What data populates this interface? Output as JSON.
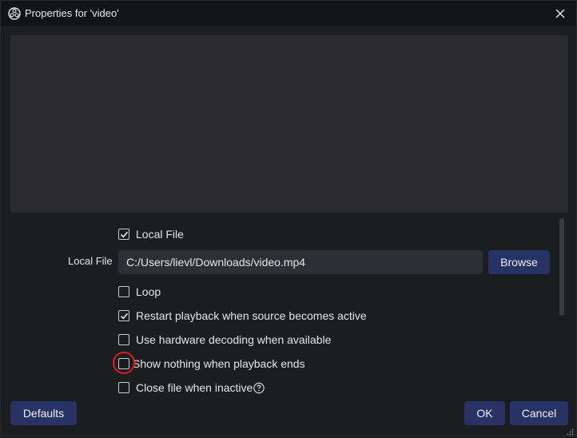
{
  "window": {
    "title": "Properties for 'video'",
    "app_icon": "obs-icon",
    "close_icon": "close-icon"
  },
  "properties": {
    "local_file_checkbox": {
      "label": "Local File",
      "checked": true
    },
    "local_file_field": {
      "label": "Local File",
      "value": "C:/Users/lievl/Downloads/video.mp4",
      "browse_label": "Browse"
    },
    "loop": {
      "label": "Loop",
      "checked": false
    },
    "restart_playback": {
      "label": "Restart playback when source becomes active",
      "checked": true
    },
    "hw_decoding": {
      "label": "Use hardware decoding when available",
      "checked": false
    },
    "show_nothing": {
      "label": "Show nothing when playback ends",
      "checked": false
    },
    "close_file": {
      "label": "Close file when inactive",
      "checked": false,
      "help_icon": "help-icon"
    }
  },
  "footer": {
    "defaults_label": "Defaults",
    "ok_label": "OK",
    "cancel_label": "Cancel"
  },
  "colors": {
    "accent_button": "#283264",
    "highlight_circle": "#e01b24",
    "preview_bg": "#2b2b2e"
  }
}
